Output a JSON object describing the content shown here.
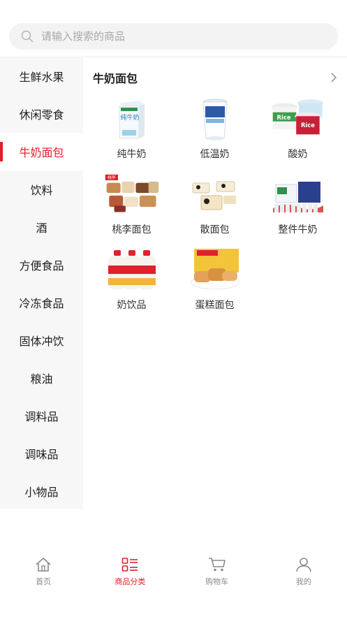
{
  "search": {
    "placeholder": "请输入搜索的商品"
  },
  "sidebar": {
    "items": [
      {
        "label": "生鲜水果"
      },
      {
        "label": "休闲零食"
      },
      {
        "label": "牛奶面包",
        "active": true
      },
      {
        "label": "饮料"
      },
      {
        "label": "酒"
      },
      {
        "label": "方便食品"
      },
      {
        "label": "冷冻食品"
      },
      {
        "label": "固体冲饮"
      },
      {
        "label": "粮油"
      },
      {
        "label": "调料品"
      },
      {
        "label": "调味品"
      },
      {
        "label": "小物品"
      }
    ]
  },
  "main": {
    "section_title": "牛奶面包",
    "products": [
      {
        "name": "纯牛奶",
        "image": "milk-carton-image",
        "carton_text": "纯牛奶"
      },
      {
        "name": "低温奶",
        "image": "milk-cup-image"
      },
      {
        "name": "酸奶",
        "image": "yogurt-cups-image",
        "brand_text": "Rice"
      },
      {
        "name": "桃李面包",
        "image": "packaged-bread-image",
        "brand_text": "桃李"
      },
      {
        "name": "散面包",
        "image": "loose-bread-image"
      },
      {
        "name": "整件牛奶",
        "image": "milk-case-image"
      },
      {
        "name": "奶饮品",
        "image": "milk-drink-bottles-image"
      },
      {
        "name": "蛋糕面包",
        "image": "cake-bread-image"
      }
    ]
  },
  "tabbar": {
    "tabs": [
      {
        "label": "首页",
        "icon": "home-icon"
      },
      {
        "label": "商品分类",
        "icon": "category-icon",
        "active": true
      },
      {
        "label": "购物车",
        "icon": "cart-icon"
      },
      {
        "label": "我的",
        "icon": "user-icon"
      }
    ]
  },
  "colors": {
    "accent": "#e0202a",
    "sidebar_bg": "#f7f7f7",
    "search_bg": "#f3f3f3",
    "inactive_tab": "#8a8a8a"
  }
}
